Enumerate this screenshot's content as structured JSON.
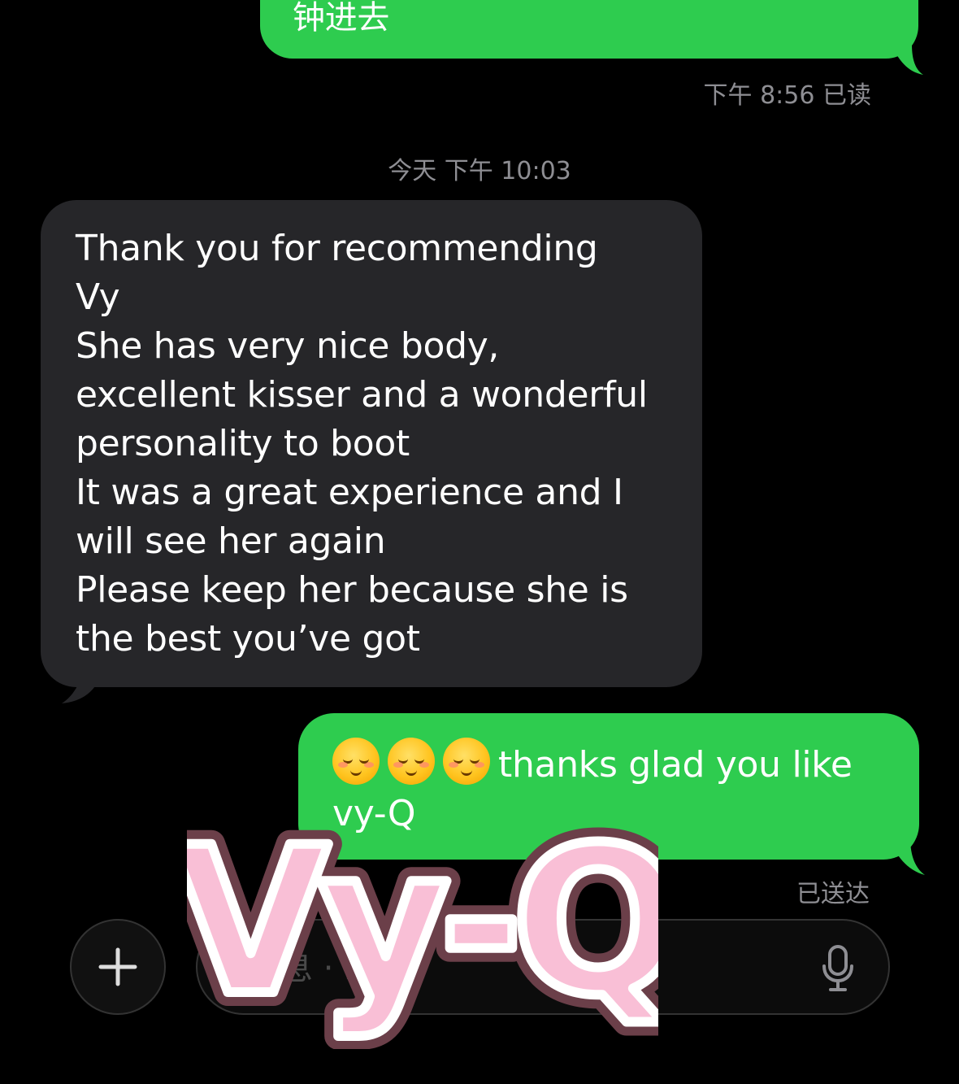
{
  "messages": {
    "prev_out_fragment": "钟进去",
    "read_status": "下午 8:56 已读",
    "day_stamp": "今天 下午 10:03",
    "incoming_text": "Thank you for recommending\nVy\nShe has very nice body,\nexcellent kisser and a wonderful\npersonality to boot\nIt was a great experience and I\nwill see her again\nPlease keep her because she is\nthe best you’ve got",
    "reply_text": "thanks glad you like\nvy-Q",
    "reply_emojis": [
      "smiling-face-icon",
      "smiling-face-icon",
      "smiling-face-icon"
    ],
    "delivered_status": "已送达"
  },
  "composer": {
    "placeholder": "息 · iCS",
    "plus_icon": "plus-icon",
    "mic_icon": "microphone-icon"
  },
  "watermark": {
    "text": "Vy-Q"
  },
  "colors": {
    "outgoing_bubble": "#2ecc4f",
    "incoming_bubble": "#262629",
    "background": "#000000",
    "meta_text": "#8e8e93",
    "watermark_fill": "#f9bfd6",
    "watermark_outline": "#6b3f49"
  }
}
